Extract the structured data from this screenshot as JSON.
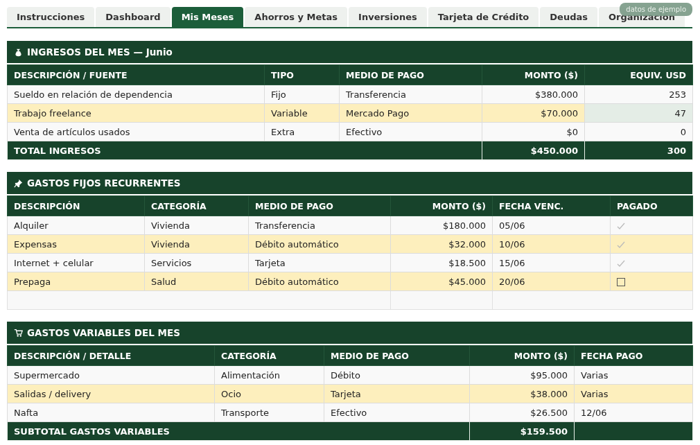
{
  "tabs": [
    {
      "label": "Instrucciones",
      "selected": false
    },
    {
      "label": "Dashboard",
      "selected": false
    },
    {
      "label": "Mis Meses",
      "selected": true
    },
    {
      "label": "Ahorros y Metas",
      "selected": false
    },
    {
      "label": "Inversiones",
      "selected": false
    },
    {
      "label": "Tarjeta de Crédito",
      "selected": false
    },
    {
      "label": "Deudas",
      "selected": false
    },
    {
      "label": "Organización",
      "selected": false
    }
  ],
  "badge": "datos de ejemplo",
  "sections": [
    {
      "title": "INGRESOS DEL MES — Junio",
      "columns": [
        "DESCRIPCIÓN / FUENTE",
        "TIPO",
        "MEDIO DE PAGO",
        "MONTO ($)",
        "EQUIV. USD"
      ],
      "rows": [
        {
          "highlighted": false,
          "cells": [
            "Sueldo en relación de dependencia",
            "Fijo",
            "Transferencia",
            "$380.000",
            "253"
          ]
        },
        {
          "highlighted": true,
          "cells": [
            "Trabajo freelance",
            "Variable",
            "Mercado Pago",
            "$70.000",
            {
              "text": "47",
              "tinted": true
            }
          ]
        },
        {
          "highlighted": false,
          "cells": [
            "Venta de artículos usados",
            "Extra",
            "Efectivo",
            "$0",
            "0"
          ]
        }
      ],
      "footer": {
        "kind": "dark",
        "label": "TOTAL INGRESOS",
        "amount": "$450.000",
        "usd": "300"
      }
    },
    {
      "title": "GASTOS FIJOS RECURRENTES",
      "columns": [
        "DESCRIPCIÓN",
        "CATEGORÍA",
        "MEDIO DE PAGO",
        "MONTO ($)",
        "FECHA VENC.",
        "PAGADO"
      ],
      "rows": [
        {
          "highlighted": false,
          "cells": [
            "Alquiler",
            "Vivienda",
            "Transferencia",
            "$180.000",
            "05/06",
            {
              "checked": true
            }
          ]
        },
        {
          "highlighted": true,
          "cells": [
            "Expensas",
            "Vivienda",
            "Débito automático",
            "$32.000",
            "10/06",
            {
              "checked": true
            }
          ]
        },
        {
          "highlighted": false,
          "cells": [
            "Internet + celular",
            "Servicios",
            "Tarjeta",
            "$18.500",
            "15/06",
            {
              "checked": true
            }
          ]
        },
        {
          "highlighted": true,
          "cells": [
            "Prepaga",
            "Salud",
            "Débito automático",
            "$45.000",
            "20/06",
            {
              "checked": false
            }
          ]
        }
      ],
      "footer": {
        "kind": "faded"
      }
    },
    {
      "title": "GASTOS VARIABLES DEL MES",
      "columns": [
        "DESCRIPCIÓN / DETALLE",
        "CATEGORÍA",
        "MEDIO DE PAGO",
        "MONTO ($)",
        "FECHA PAGO"
      ],
      "rows": [
        {
          "highlighted": false,
          "cells": [
            "Supermercado",
            "Alimentación",
            "Débito",
            "$95.000",
            "Varias"
          ]
        },
        {
          "highlighted": true,
          "cells": [
            "Salidas / delivery",
            "Ocio",
            "Tarjeta",
            "$38.000",
            "Varias"
          ]
        },
        {
          "highlighted": false,
          "cells": [
            "Nafta",
            "Transporte",
            "Efectivo",
            "$26.500",
            "12/06"
          ]
        }
      ],
      "footer": {
        "kind": "dark",
        "label": "SUBTOTAL GASTOS VARIABLES",
        "amount": "$159.500"
      }
    }
  ]
}
